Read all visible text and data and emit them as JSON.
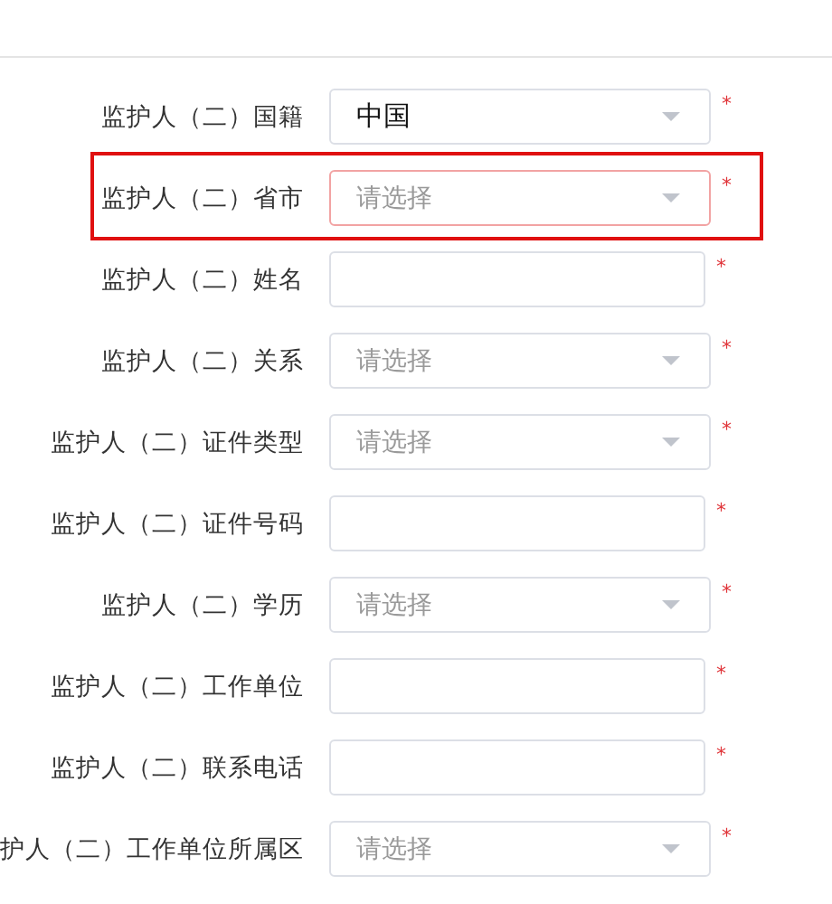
{
  "form": {
    "rows": [
      {
        "label": "监护人（二）国籍",
        "kind": "select",
        "value": "中国",
        "required_mark": "*",
        "highlighted": false
      },
      {
        "label": "监护人（二）省市",
        "kind": "select",
        "placeholder": "请选择",
        "required_mark": "*",
        "highlighted": true
      },
      {
        "label": "监护人（二）姓名",
        "kind": "text",
        "required_mark": "*",
        "highlighted": false
      },
      {
        "label": "监护人（二）关系",
        "kind": "select",
        "placeholder": "请选择",
        "required_mark": "*",
        "highlighted": false
      },
      {
        "label": "监护人（二）证件类型",
        "kind": "select",
        "placeholder": "请选择",
        "required_mark": "*",
        "highlighted": false
      },
      {
        "label": "监护人（二）证件号码",
        "kind": "text",
        "required_mark": "*",
        "highlighted": false
      },
      {
        "label": "监护人（二）学历",
        "kind": "select",
        "placeholder": "请选择",
        "required_mark": "*",
        "highlighted": false
      },
      {
        "label": "监护人（二）工作单位",
        "kind": "text",
        "required_mark": "*",
        "highlighted": false
      },
      {
        "label": "监护人（二）联系电话",
        "kind": "text",
        "required_mark": "*",
        "highlighted": false
      },
      {
        "label": "护人（二）工作单位所属区",
        "kind": "select",
        "placeholder": "请选择",
        "required_mark": "*",
        "highlighted": false
      }
    ]
  }
}
